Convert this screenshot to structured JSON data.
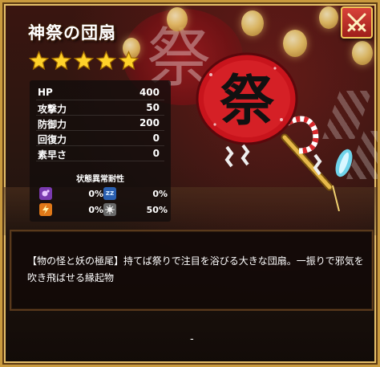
{
  "item": {
    "name": "神祭の団扇",
    "rarity_stars": 5,
    "description": "【物の怪と妖の極尾】持てば祭りで注目を浴びる大きな団扇。一振りで邪気を吹き飛ばせる縁起物",
    "footer": "-"
  },
  "stats": [
    {
      "label": "HP",
      "value": "400"
    },
    {
      "label": "攻撃力",
      "value": "50"
    },
    {
      "label": "防御力",
      "value": "200"
    },
    {
      "label": "回復力",
      "value": "0"
    },
    {
      "label": "素早さ",
      "value": "0"
    }
  ],
  "resistance": {
    "header": "状態異常耐性",
    "items": [
      {
        "icon": "poison-icon",
        "value": "0%"
      },
      {
        "icon": "sleep-icon",
        "value": "0%"
      },
      {
        "icon": "paralysis-icon",
        "value": "0%"
      },
      {
        "icon": "stun-icon",
        "value": "50%"
      }
    ]
  },
  "art": {
    "emblem_char": "祭",
    "background_char": "祭"
  },
  "colors": {
    "frame_gold": "#c99a3e",
    "close_red": "#c0302a",
    "fan_red": "#d0161e",
    "star_gold": "#ffd22a"
  }
}
